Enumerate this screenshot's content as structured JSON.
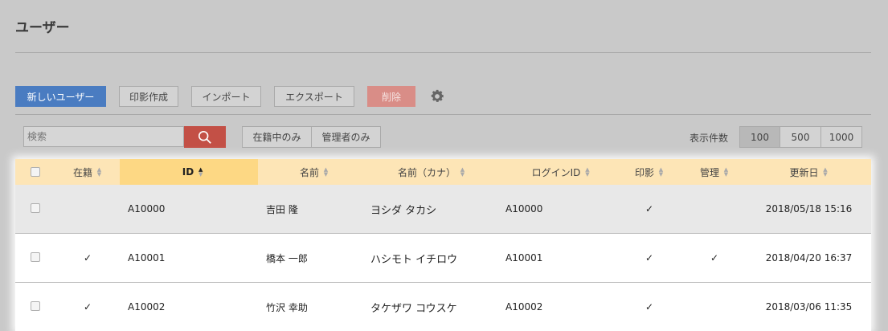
{
  "page": {
    "title": "ユーザー"
  },
  "toolbar": {
    "new_user": "新しいユーザー",
    "print_seal": "印影作成",
    "import": "インポート",
    "export": "エクスポート",
    "delete": "削除"
  },
  "search": {
    "placeholder": "検索"
  },
  "filters": {
    "active_only": "在籍中のみ",
    "admin_only": "管理者のみ"
  },
  "display": {
    "label": "表示件数",
    "sizes": [
      "100",
      "500",
      "1000"
    ],
    "selected": "100"
  },
  "table": {
    "headers": [
      "在籍",
      "ID",
      "名前",
      "名前（カナ）",
      "ログインID",
      "印影",
      "管理",
      "更新日"
    ],
    "sorted_by": "ID",
    "rows": [
      {
        "active": "",
        "id": "A10000",
        "name": "吉田 隆",
        "kana": "ヨシダ タカシ",
        "login": "A10000",
        "seal": "✓",
        "admin": "",
        "updated": "2018/05/18 15:16"
      },
      {
        "active": "✓",
        "id": "A10001",
        "name": "橋本 一郎",
        "kana": "ハシモト イチロウ",
        "login": "A10001",
        "seal": "✓",
        "admin": "✓",
        "updated": "2018/04/20 16:37"
      },
      {
        "active": "✓",
        "id": "A10002",
        "name": "竹沢 幸助",
        "kana": "タケザワ コウスケ",
        "login": "A10002",
        "seal": "✓",
        "admin": "",
        "updated": "2018/03/06 11:35"
      }
    ]
  },
  "icons": {
    "settings": "gear-icon",
    "search": "search-icon",
    "sort": "sort-icon"
  },
  "colors": {
    "primary": "#4a7cc1",
    "danger": "#d98d87",
    "search_button": "#c35046",
    "header": "#fde5b6",
    "active_header": "#fdd884"
  }
}
